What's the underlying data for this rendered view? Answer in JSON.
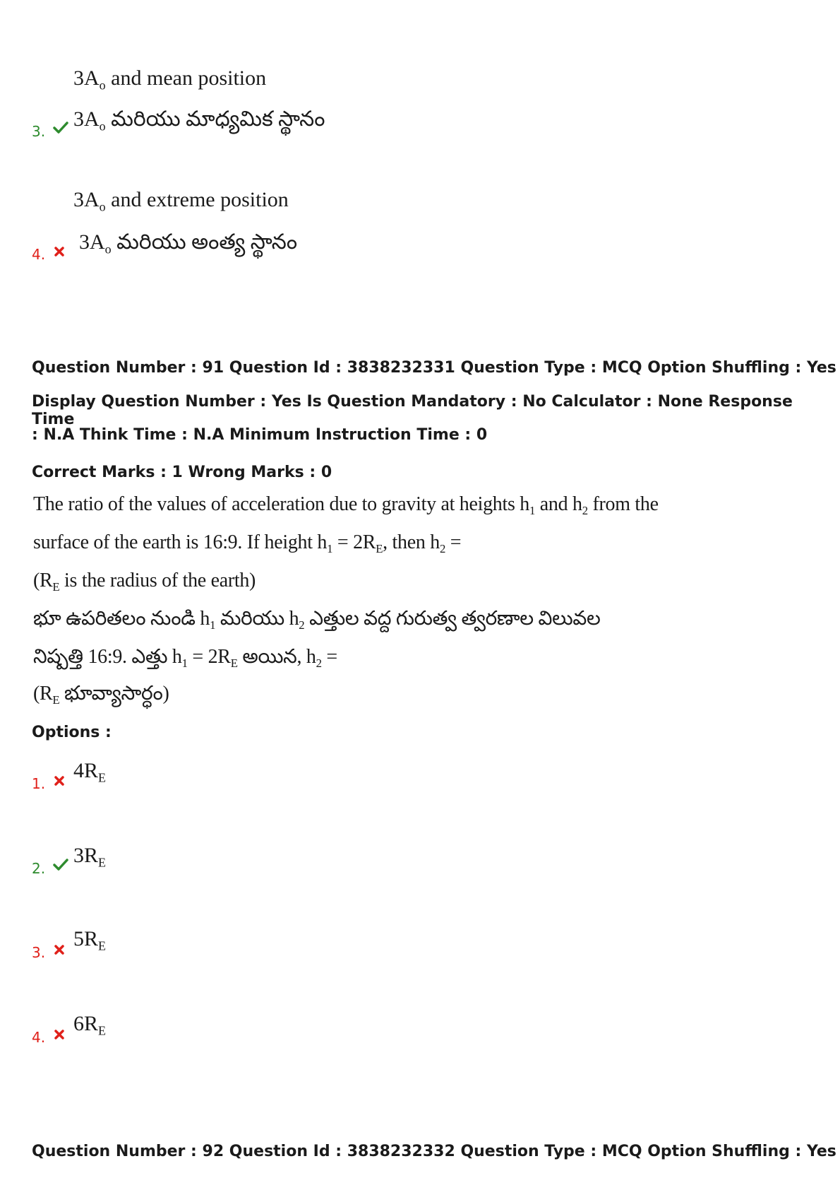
{
  "prev_question_tail": {
    "option3": {
      "number": "3.",
      "status": "correct",
      "en_prefix": "3A",
      "en_sub": "o",
      "en_text": " and mean position",
      "te_prefix": "3A",
      "te_sub": "o",
      "te_text": " మరియు మాధ్యమిక స్థానం"
    },
    "option4": {
      "number": "4.",
      "status": "wrong",
      "en_prefix": "3A",
      "en_sub": "o",
      "en_text": " and extreme position",
      "te_prefix": "3A",
      "te_sub": "o",
      "te_text": " మరియు అంత్య స్థానం"
    }
  },
  "question91": {
    "meta_line1": "Question Number : 91 Question Id : 3838232331 Question Type : MCQ Option Shuffling : Yes",
    "meta_line2": "Display Question Number : Yes Is Question Mandatory : No Calculator : None Response Time",
    "meta_line3": ": N.A Think Time : N.A Minimum Instruction Time : 0",
    "marks_line": "Correct Marks : 1 Wrong Marks : 0",
    "en_line1_a": "The ratio of the values of acceleration due to gravity at heights ",
    "en_line1_h1": "h",
    "en_line1_h1_sub": "1",
    "en_line1_and": " and ",
    "en_line1_h2": "h",
    "en_line1_h2_sub": "2",
    "en_line1_b": " from the",
    "en_line2_a": "surface of the earth is 16:9.  If height ",
    "en_line2_h1": "h",
    "en_line2_h1_sub": "1",
    "en_line2_eq": " = 2R",
    "en_line2_eq_sub": "E",
    "en_line2_then": ", then ",
    "en_line2_h2": "h",
    "en_line2_h2_sub": "2",
    "en_line2_end": " =",
    "en_line3_a": "(R",
    "en_line3_sub": "E",
    "en_line3_b": " is the radius of the earth)",
    "te_line1_a": "భూ ఉపరితలం నుండి ",
    "te_line1_h1": "h",
    "te_line1_h1_sub": "1",
    "te_line1_mid": " మరియు ",
    "te_line1_h2": "h",
    "te_line1_h2_sub": "2",
    "te_line1_b": " ఎత్తుల వద్ద గురుత్వ త్వరణాల విలువల",
    "te_line2_a": "నిష్పత్తి 16:9. ఎత్తు ",
    "te_line2_h1": "h",
    "te_line2_h1_sub": "1",
    "te_line2_eq": " = 2R",
    "te_line2_eq_sub": "E",
    "te_line2_mid": " అయిన, ",
    "te_line2_h2": "h",
    "te_line2_h2_sub": "2",
    "te_line2_end": " =",
    "te_line3_a": "(R",
    "te_line3_sub": "E",
    "te_line3_b": " భూవ్యాసార్ధం)",
    "options_label": "Options :",
    "options": [
      {
        "number": "1.",
        "status": "wrong",
        "value": "4R",
        "sub": "E"
      },
      {
        "number": "2.",
        "status": "correct",
        "value": "3R",
        "sub": "E"
      },
      {
        "number": "3.",
        "status": "wrong",
        "value": "5R",
        "sub": "E"
      },
      {
        "number": "4.",
        "status": "wrong",
        "value": "6R",
        "sub": "E"
      }
    ]
  },
  "question92": {
    "meta_line1": "Question Number : 92 Question Id : 3838232332 Question Type : MCQ Option Shuffling : Yes"
  },
  "icons": {
    "correct": "check-icon",
    "wrong": "cross-icon"
  },
  "colors": {
    "correct": "#2e8b2e",
    "wrong": "#e0201a"
  }
}
